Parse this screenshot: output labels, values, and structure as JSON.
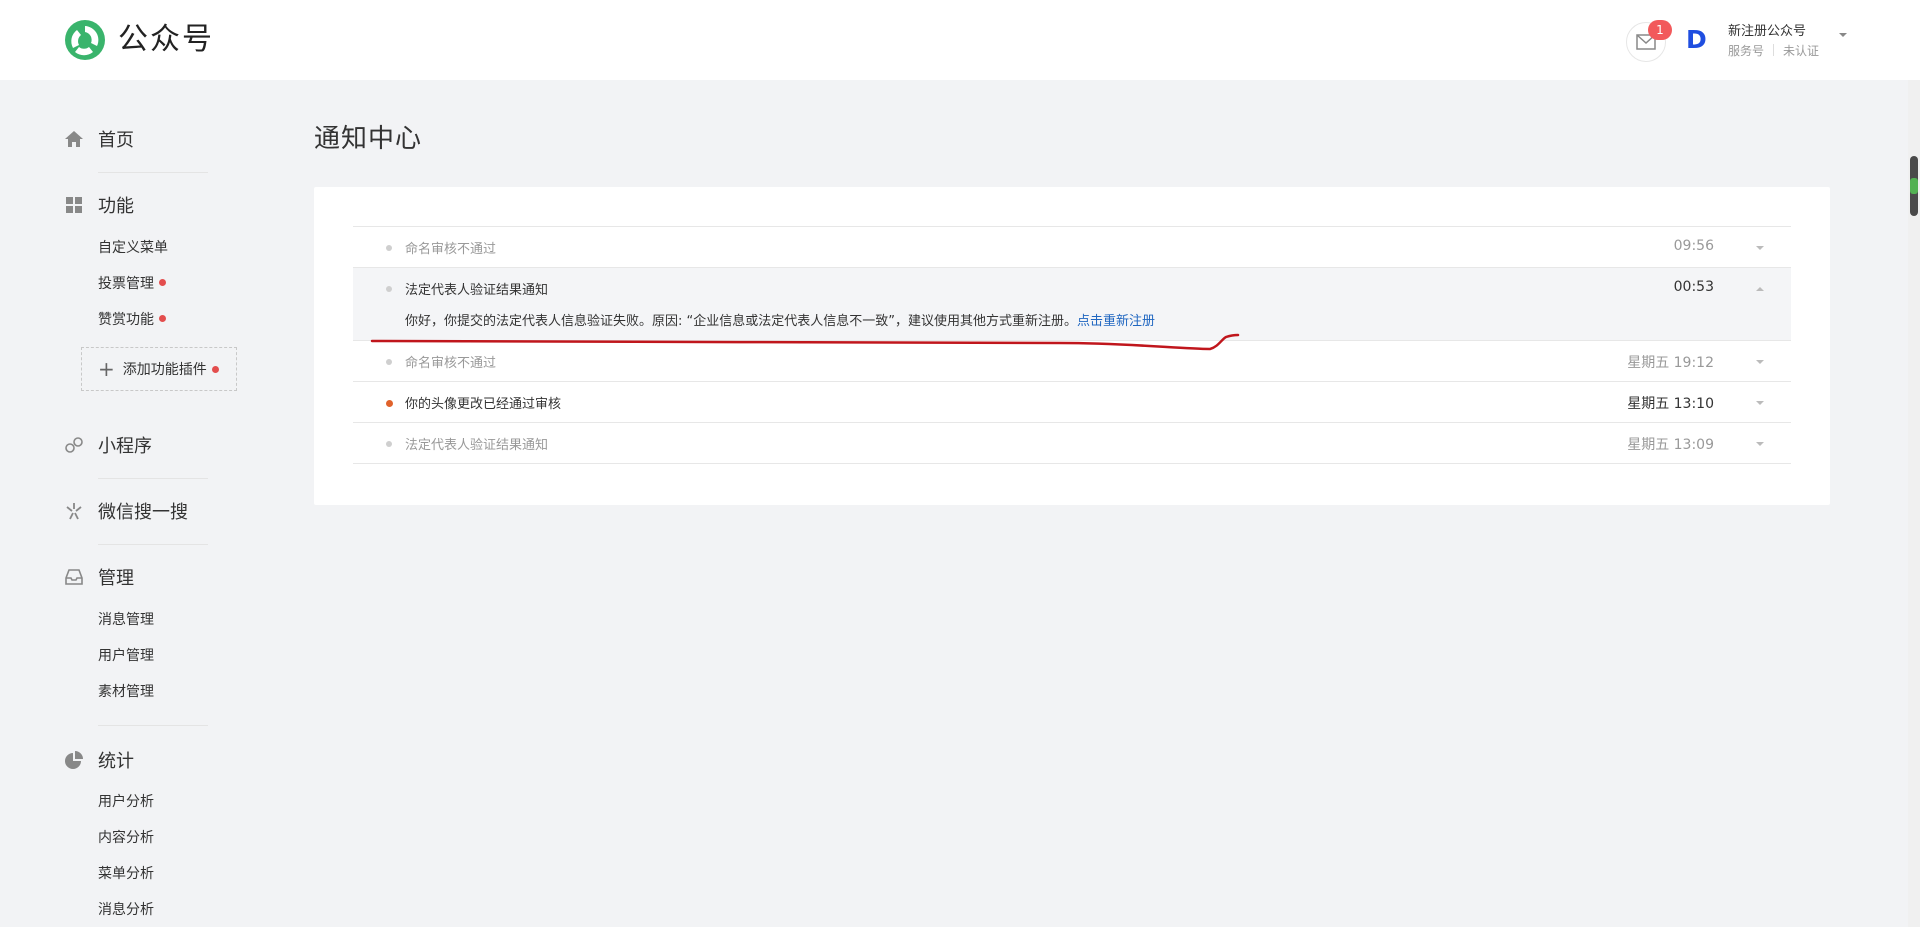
{
  "header": {
    "brand": "公众号",
    "mail_badge": "1",
    "account_avatar_letter": "D",
    "account_name": "新注册公众号",
    "account_type": "服务号",
    "account_status": "未认证"
  },
  "sidebar": {
    "home": "首页",
    "features": "功能",
    "features_items": [
      "自定义菜单",
      "投票管理",
      "赞赏功能"
    ],
    "add_plugin": "添加功能插件",
    "mini_program": "小程序",
    "wechat_search": "微信搜一搜",
    "manage": "管理",
    "manage_items": [
      "消息管理",
      "用户管理",
      "素材管理"
    ],
    "stats": "统计",
    "stats_items": [
      "用户分析",
      "内容分析",
      "菜单分析",
      "消息分析"
    ]
  },
  "main": {
    "title": "通知中心",
    "notices": [
      {
        "title": "命名审核不通过",
        "time": "09:56"
      },
      {
        "title": "法定代表人验证结果通知",
        "time": "00:53",
        "body": "你好，你提交的法定代表人信息验证失败。原因: “企业信息或法定代表人信息不一致”，建议使用其他方式重新注册。",
        "link": "点击重新注册"
      },
      {
        "title": "命名审核不通过",
        "time": "星期五 19:12"
      },
      {
        "title": "你的头像更改已经通过审核",
        "time": "星期五 13:10"
      },
      {
        "title": "法定代表人验证结果通知",
        "time": "星期五 13:09"
      }
    ]
  },
  "colors": {
    "brand_green": "#3ab46c",
    "unread_dot": "#e0622b",
    "badge_red": "#f2595b",
    "link_blue": "#1f66c0",
    "annotation_red": "#c0161c"
  }
}
